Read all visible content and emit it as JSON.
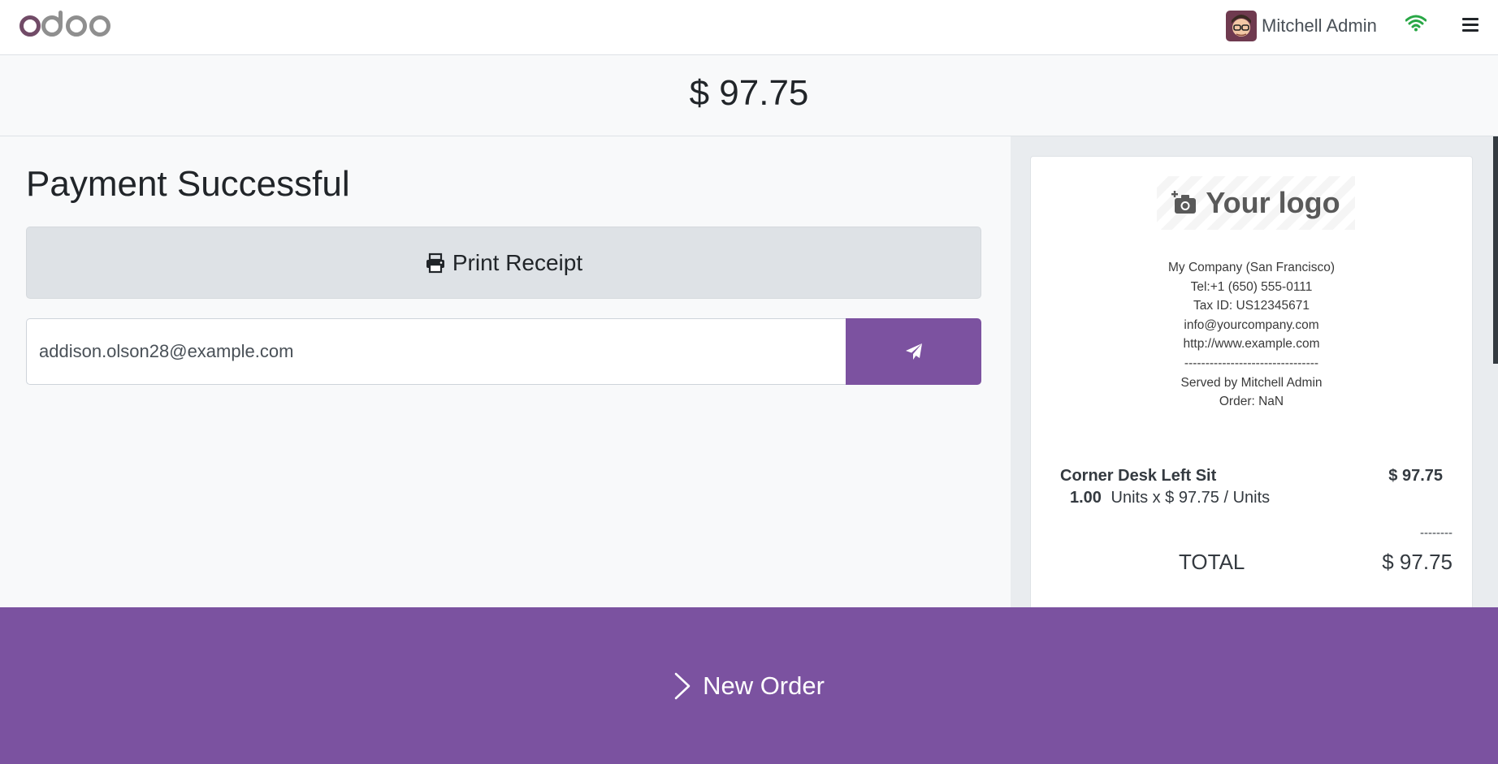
{
  "navbar": {
    "brand": "odoo",
    "user_name": "Mitchell Admin",
    "icons": [
      "avatar",
      "wifi-icon",
      "menu-icon"
    ],
    "connection_color": "#28a745"
  },
  "amount": {
    "value": "$ 97.75"
  },
  "payment": {
    "title": "Payment Successful",
    "print_label": "Print Receipt",
    "email_value": "addison.olson28@example.com",
    "send_icon": "paper-plane-icon"
  },
  "receipt": {
    "logo_text": "Your logo",
    "company_lines": [
      "My Company (San Francisco)",
      "Tel:+1 (650) 555-0111",
      "Tax ID: US12345671",
      "info@yourcompany.com",
      "http://www.example.com",
      "--------------------------------",
      "Served by Mitchell Admin",
      "Order: NaN"
    ],
    "item": {
      "name": "Corner Desk Left Sit",
      "price": "$ 97.75",
      "qty": "1.00",
      "detail": "Units x $ 97.75 / Units"
    },
    "dashes": "--------",
    "total_label": "TOTAL",
    "total_value": "$ 97.75"
  },
  "footer": {
    "new_order_label": "New Order"
  },
  "colors": {
    "brand_purple": "#7b52a0",
    "secondary_btn": "#dee2e6"
  }
}
